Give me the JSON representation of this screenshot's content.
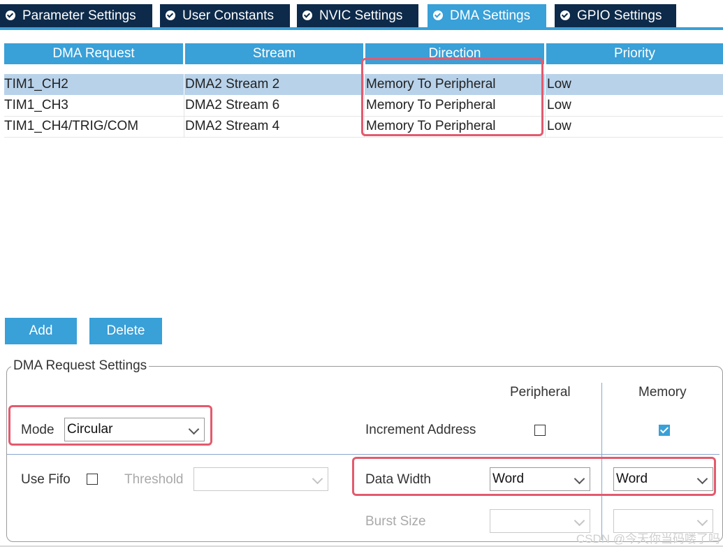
{
  "tabs": [
    {
      "label": "Parameter Settings"
    },
    {
      "label": "User Constants"
    },
    {
      "label": "NVIC Settings"
    },
    {
      "label": "DMA Settings"
    },
    {
      "label": "GPIO Settings"
    }
  ],
  "table": {
    "headers": [
      "DMA Request",
      "Stream",
      "Direction",
      "Priority"
    ],
    "rows": [
      [
        "TIM1_CH2",
        "DMA2 Stream 2",
        "Memory To Peripheral",
        "Low"
      ],
      [
        "TIM1_CH3",
        "DMA2 Stream 6",
        "Memory To Peripheral",
        "Low"
      ],
      [
        "TIM1_CH4/TRIG/COM",
        "DMA2 Stream 4",
        "Memory To Peripheral",
        "Low"
      ]
    ]
  },
  "buttons": {
    "add": "Add",
    "delete": "Delete"
  },
  "settings": {
    "title": "DMA Request Settings",
    "peripheral_col": "Peripheral",
    "memory_col": "Memory",
    "mode_label": "Mode",
    "mode_value": "Circular",
    "increment_label": "Increment Address",
    "use_fifo_label": "Use Fifo",
    "threshold_label": "Threshold",
    "data_width_label": "Data Width",
    "data_width_peripheral": "Word",
    "data_width_memory": "Word",
    "burst_size_label": "Burst Size"
  },
  "watermark": "CSDN @今天你当码喽了吗",
  "colors": {
    "accent": "#39a0d8",
    "tab_dark": "#0d2a4a",
    "highlight": "#e35a6e",
    "selected_row": "#b8d2ea"
  }
}
